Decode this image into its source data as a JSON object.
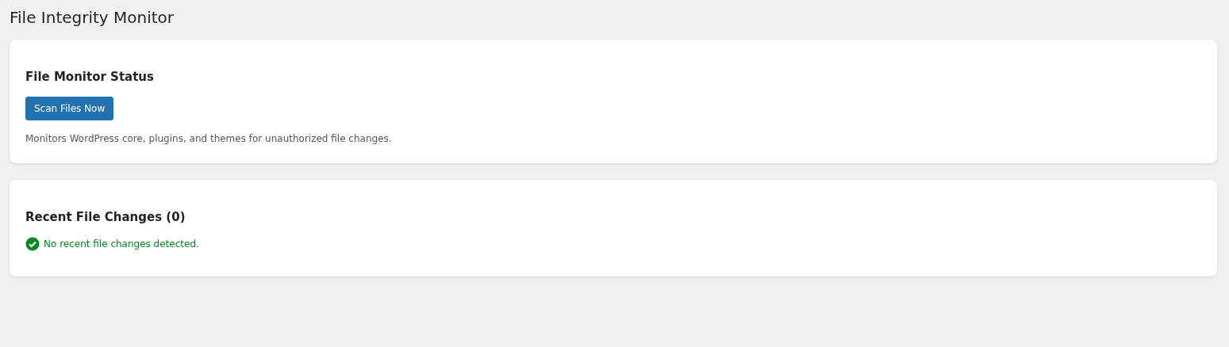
{
  "page": {
    "title": "File Integrity Monitor"
  },
  "status_card": {
    "heading": "File Monitor Status",
    "button": "Scan Files Now",
    "description": "Monitors WordPress core, plugins, and themes for unauthorized file changes."
  },
  "changes_card": {
    "heading": "Recent File Changes (0)",
    "message": {
      "kind": "success",
      "text": "No recent file changes detected."
    }
  }
}
